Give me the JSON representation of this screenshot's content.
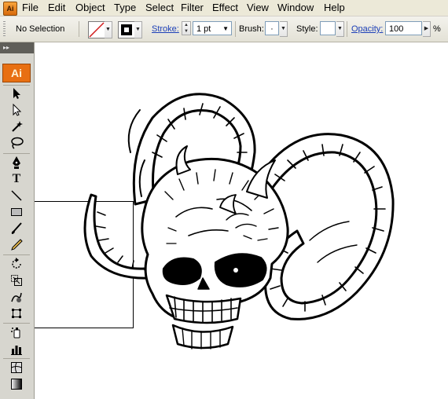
{
  "menubar": {
    "items": [
      "File",
      "Edit",
      "Object",
      "Type",
      "Select",
      "Filter",
      "Effect",
      "View",
      "Window",
      "Help"
    ]
  },
  "controlbar": {
    "selection_status": "No Selection",
    "stroke_label": "Stroke:",
    "stroke_weight": "1 pt",
    "brush_label": "Brush:",
    "brush_value": "·",
    "style_label": "Style:",
    "opacity_label": "Opacity:",
    "opacity_value": "100",
    "opacity_unit": "%"
  },
  "tools": {
    "panel_grip": "▸▸",
    "logo": "Ai",
    "items": [
      "selection",
      "direct-selection",
      "magic-wand",
      "lasso",
      "pen",
      "type",
      "line-segment",
      "rectangle",
      "paintbrush",
      "pencil",
      "rotate",
      "scale",
      "warp",
      "free-transform",
      "symbol-sprayer",
      "column-graph",
      "mesh",
      "gradient"
    ]
  },
  "colors": {
    "menubar_bg": "#ece9d8",
    "panel_bg": "#d7d6cf",
    "ai_orange": "#e86f12",
    "link_blue": "#1c3fb8"
  }
}
